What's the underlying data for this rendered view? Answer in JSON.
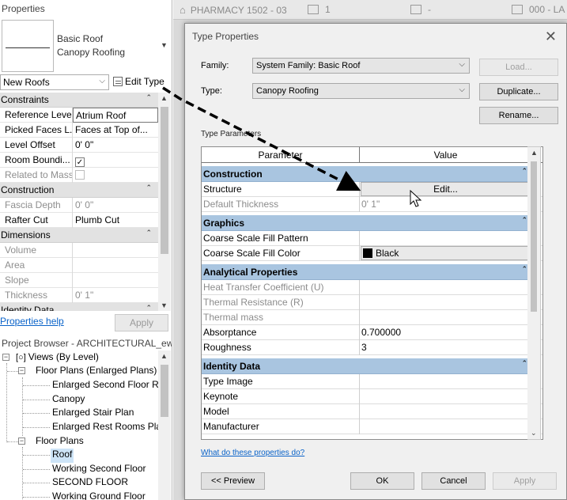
{
  "properties_panel": {
    "title": "Properties",
    "type_name_line1": "Basic Roof",
    "type_name_line2": "Canopy Roofing",
    "filter_value": "New Roofs",
    "edit_type_label": "Edit Type",
    "sections": [
      {
        "label": "Constraints",
        "rows": [
          {
            "name": "Reference Level",
            "value": "Atrium Roof"
          },
          {
            "name": "Picked Faces L...",
            "value": "Faces at Top of..."
          },
          {
            "name": "Level Offset",
            "value": "0'  0\""
          },
          {
            "name": "Room Boundi...",
            "value": "checked"
          },
          {
            "name": "Related to Mass",
            "value": "unchecked"
          }
        ]
      },
      {
        "label": "Construction",
        "rows": [
          {
            "name": "Fascia Depth",
            "value": "0'  0\""
          },
          {
            "name": "Rafter Cut",
            "value": "Plumb Cut"
          }
        ]
      },
      {
        "label": "Dimensions",
        "rows": [
          {
            "name": "Volume",
            "value": ""
          },
          {
            "name": "Area",
            "value": ""
          },
          {
            "name": "Slope",
            "value": ""
          },
          {
            "name": "Thickness",
            "value": "0'  1\""
          }
        ]
      },
      {
        "label": "Identity Data",
        "rows": []
      }
    ],
    "help_link": "Properties help",
    "apply_label": "Apply"
  },
  "project_browser": {
    "title": "Project Browser - ARCHITECTURAL_ew...",
    "root": "Views (By Level)",
    "groups": [
      {
        "label": "Floor Plans (Enlarged Plans)",
        "items": [
          "Enlarged Second Floor R",
          "Canopy",
          "Enlarged Stair Plan",
          "Enlarged Rest Rooms Pla"
        ]
      },
      {
        "label": "Floor Plans",
        "items": [
          "Roof",
          "Working Second Floor",
          "SECOND FLOOR",
          "Working Ground Floor"
        ]
      }
    ]
  },
  "tabs": [
    "PHARMACY 1502 - 03",
    "1",
    "-",
    "000 - LA"
  ],
  "dialog": {
    "title": "Type Properties",
    "family_label": "Family:",
    "family_value": "System Family: Basic Roof",
    "type_label": "Type:",
    "type_value": "Canopy Roofing",
    "load_label": "Load...",
    "duplicate_label": "Duplicate...",
    "rename_label": "Rename...",
    "type_parameters_label": "Type Parameters",
    "col_parameter": "Parameter",
    "col_value": "Value",
    "col_eq": "=",
    "construction_label": "Construction",
    "structure_label": "Structure",
    "edit_label": "Edit...",
    "default_thickness_label": "Default Thickness",
    "default_thickness_value": "0'  1\"",
    "graphics_label": "Graphics",
    "coarse_pattern_label": "Coarse Scale Fill Pattern",
    "coarse_pattern_value": "",
    "coarse_color_label": "Coarse Scale Fill Color",
    "coarse_color_value": "Black",
    "analytical_label": "Analytical Properties",
    "heat_label": "Heat Transfer Coefficient (U)",
    "heat_value": "",
    "thermal_res_label": "Thermal Resistance (R)",
    "thermal_res_value": "",
    "thermal_mass_label": "Thermal mass",
    "thermal_mass_value": "",
    "absorptance_label": "Absorptance",
    "absorptance_value": "0.700000",
    "roughness_label": "Roughness",
    "roughness_value": "3",
    "identity_label": "Identity Data",
    "type_image_label": "Type Image",
    "type_image_value": "",
    "keynote_label": "Keynote",
    "keynote_value": "",
    "model_label": "Model",
    "model_value": "",
    "manufacturer_label": "Manufacturer",
    "manufacturer_value": "",
    "help_link": "What do these properties do?",
    "preview_label": "<< Preview",
    "ok_label": "OK",
    "cancel_label": "Cancel",
    "apply_label": "Apply"
  },
  "colors": {
    "category_band": "#a9c5e0",
    "link": "#0a63c9",
    "arrow": "#000000"
  }
}
